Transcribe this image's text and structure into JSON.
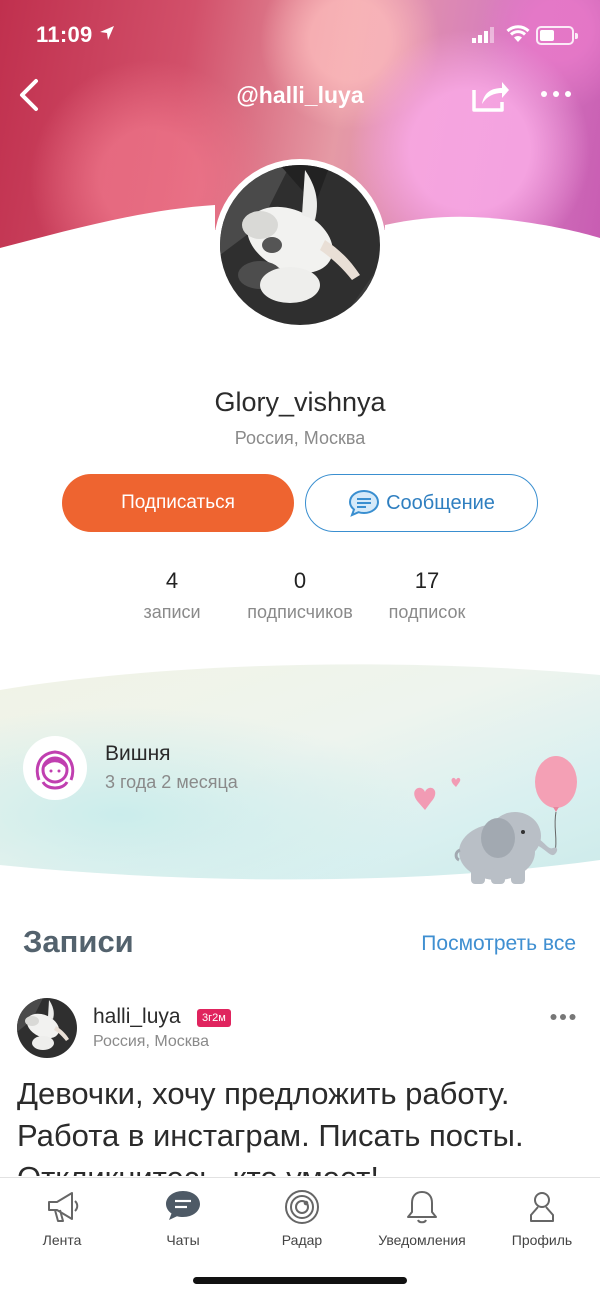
{
  "status_bar": {
    "time": "11:09"
  },
  "nav": {
    "title": "@halli_luya",
    "back_icon": "chevron-left-icon",
    "share_icon": "share-icon",
    "more_icon": "more-dots-icon"
  },
  "profile": {
    "username": "Glory_vishnya",
    "location": "Россия, Москва",
    "subscribe_label": "Подписаться",
    "message_label": "Сообщение",
    "stats": [
      {
        "value": "4",
        "label": "записи"
      },
      {
        "value": "0",
        "label": "подписчиков"
      },
      {
        "value": "17",
        "label": "подписок"
      }
    ]
  },
  "child_card": {
    "name": "Вишня",
    "age": "3 года 2 месяца"
  },
  "posts_section": {
    "title": "Записи",
    "see_all_label": "Посмотреть все",
    "post": {
      "author": "halli_luya",
      "badge": "3г2м",
      "location": "Россия, Москва",
      "text": "Девочки, хочу предложить работу. Работа в инстаграм. Писать посты. Откликнитесь, кто умеет!"
    }
  },
  "tabbar": {
    "items": [
      {
        "label": "Лента",
        "icon": "megaphone-icon"
      },
      {
        "label": "Чаты",
        "icon": "chat-bubble-icon"
      },
      {
        "label": "Радар",
        "icon": "radar-icon"
      },
      {
        "label": "Уведомления",
        "icon": "bell-icon"
      },
      {
        "label": "Профиль",
        "icon": "profile-icon"
      }
    ]
  },
  "colors": {
    "accent_orange": "#ee6430",
    "link_blue": "#3f8fd1",
    "badge_pink": "#e0245e"
  }
}
